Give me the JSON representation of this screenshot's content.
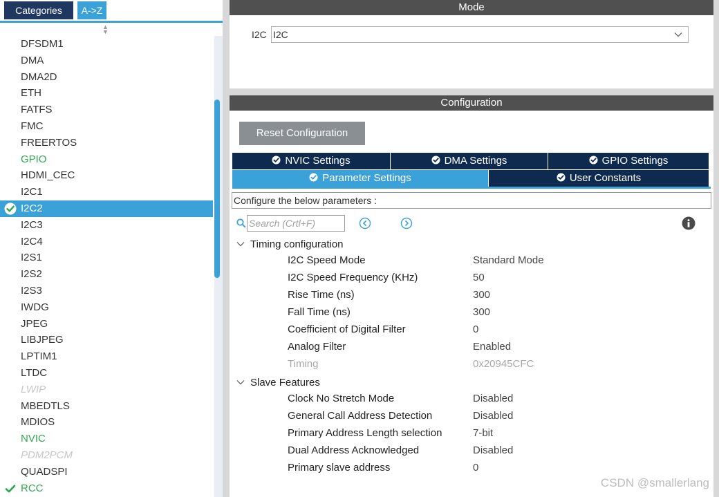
{
  "left_panel": {
    "tabs": {
      "categories": "Categories",
      "az": "A->Z"
    },
    "items": [
      {
        "label": "DFSDM1",
        "state": "normal"
      },
      {
        "label": "DMA",
        "state": "normal"
      },
      {
        "label": "DMA2D",
        "state": "normal"
      },
      {
        "label": "ETH",
        "state": "normal"
      },
      {
        "label": "FATFS",
        "state": "normal"
      },
      {
        "label": "FMC",
        "state": "normal"
      },
      {
        "label": "FREERTOS",
        "state": "normal"
      },
      {
        "label": "GPIO",
        "state": "green"
      },
      {
        "label": "HDMI_CEC",
        "state": "normal"
      },
      {
        "label": "I2C1",
        "state": "normal"
      },
      {
        "label": "I2C2",
        "state": "selected"
      },
      {
        "label": "I2C3",
        "state": "normal"
      },
      {
        "label": "I2C4",
        "state": "normal"
      },
      {
        "label": "I2S1",
        "state": "normal"
      },
      {
        "label": "I2S2",
        "state": "normal"
      },
      {
        "label": "I2S3",
        "state": "normal"
      },
      {
        "label": "IWDG",
        "state": "normal"
      },
      {
        "label": "JPEG",
        "state": "normal"
      },
      {
        "label": "LIBJPEG",
        "state": "normal"
      },
      {
        "label": "LPTIM1",
        "state": "normal"
      },
      {
        "label": "LTDC",
        "state": "normal"
      },
      {
        "label": "LWIP",
        "state": "disabled"
      },
      {
        "label": "MBEDTLS",
        "state": "normal"
      },
      {
        "label": "MDIOS",
        "state": "normal"
      },
      {
        "label": "NVIC",
        "state": "green"
      },
      {
        "label": "PDM2PCM",
        "state": "disabled"
      },
      {
        "label": "QUADSPI",
        "state": "normal"
      },
      {
        "label": "RCC",
        "state": "green-check"
      }
    ]
  },
  "mode": {
    "title": "Mode",
    "label": "I2C",
    "value": "I2C"
  },
  "configuration": {
    "title": "Configuration",
    "reset_label": "Reset Configuration",
    "tabs": {
      "nvic": "NVIC Settings",
      "dma": "DMA Settings",
      "gpio": "GPIO Settings",
      "parameter": "Parameter Settings",
      "user_constants": "User Constants"
    },
    "hint": "Configure the below parameters :",
    "search_placeholder": "Search (Crtl+F)",
    "groups": {
      "timing": {
        "title": "Timing configuration",
        "params": [
          {
            "name": "I2C Speed Mode",
            "value": "Standard Mode"
          },
          {
            "name": "I2C Speed Frequency (KHz)",
            "value": "50"
          },
          {
            "name": "Rise Time (ns)",
            "value": "300"
          },
          {
            "name": "Fall Time (ns)",
            "value": "300"
          },
          {
            "name": "Coefficient of Digital Filter",
            "value": "0"
          },
          {
            "name": "Analog Filter",
            "value": "Enabled"
          },
          {
            "name": "Timing",
            "value": "0x20945CFC",
            "readonly": true
          }
        ]
      },
      "slave": {
        "title": "Slave Features",
        "params": [
          {
            "name": "Clock No Stretch Mode",
            "value": "Disabled"
          },
          {
            "name": "General Call Address Detection",
            "value": "Disabled"
          },
          {
            "name": "Primary Address Length selection",
            "value": "7-bit"
          },
          {
            "name": "Dual Address Acknowledged",
            "value": "Disabled"
          },
          {
            "name": "Primary slave address",
            "value": "0"
          }
        ]
      }
    }
  },
  "watermark": "CSDN @smallerlang",
  "colors": {
    "accent": "#3aa1d9",
    "navy": "#0e2a4e",
    "header": "#505050",
    "green": "#2fa84f"
  }
}
